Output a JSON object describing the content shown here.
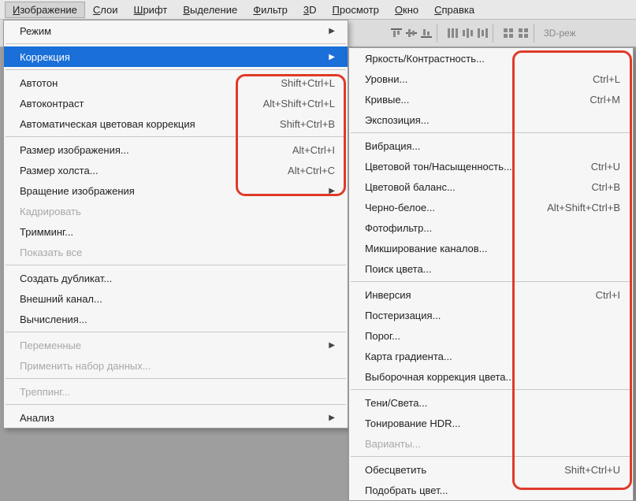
{
  "menubar": {
    "items": [
      {
        "label": "Изображение",
        "ukey": "И"
      },
      {
        "label": "Слои",
        "ukey": "С"
      },
      {
        "label": "Шрифт",
        "ukey": "Ш"
      },
      {
        "label": "Выделение",
        "ukey": "В"
      },
      {
        "label": "Фильтр",
        "ukey": "Ф"
      },
      {
        "label": "3D",
        "ukey": "3"
      },
      {
        "label": "Просмотр",
        "ukey": "П"
      },
      {
        "label": "Окно",
        "ukey": "О"
      },
      {
        "label": "Справка",
        "ukey": "С"
      }
    ]
  },
  "toolbar": {
    "mode_label": "3D-реж"
  },
  "menu1": {
    "groups": [
      [
        {
          "label": "Режим",
          "submenu": true
        }
      ],
      [
        {
          "label": "Коррекция",
          "submenu": true,
          "highlighted": true
        }
      ],
      [
        {
          "label": "Автотон",
          "shortcut": "Shift+Ctrl+L"
        },
        {
          "label": "Автоконтраст",
          "shortcut": "Alt+Shift+Ctrl+L"
        },
        {
          "label": "Автоматическая цветовая коррекция",
          "shortcut": "Shift+Ctrl+B"
        }
      ],
      [
        {
          "label": "Размер изображения...",
          "shortcut": "Alt+Ctrl+I"
        },
        {
          "label": "Размер холста...",
          "shortcut": "Alt+Ctrl+C"
        },
        {
          "label": "Вращение изображения",
          "submenu": true
        },
        {
          "label": "Кадрировать",
          "disabled": true
        },
        {
          "label": "Тримминг..."
        },
        {
          "label": "Показать все",
          "disabled": true
        }
      ],
      [
        {
          "label": "Создать дубликат..."
        },
        {
          "label": "Внешний канал..."
        },
        {
          "label": "Вычисления..."
        }
      ],
      [
        {
          "label": "Переменные",
          "submenu": true,
          "disabled": true
        },
        {
          "label": "Применить набор данных...",
          "disabled": true
        }
      ],
      [
        {
          "label": "Треппинг...",
          "disabled": true
        }
      ],
      [
        {
          "label": "Анализ",
          "submenu": true
        }
      ]
    ]
  },
  "menu2": {
    "groups": [
      [
        {
          "label": "Яркость/Контрастность..."
        },
        {
          "label": "Уровни...",
          "shortcut": "Ctrl+L"
        },
        {
          "label": "Кривые...",
          "shortcut": "Ctrl+M"
        },
        {
          "label": "Экспозиция..."
        }
      ],
      [
        {
          "label": "Вибрация..."
        },
        {
          "label": "Цветовой тон/Насыщенность...",
          "shortcut": "Ctrl+U"
        },
        {
          "label": "Цветовой баланс...",
          "shortcut": "Ctrl+B"
        },
        {
          "label": "Черно-белое...",
          "shortcut": "Alt+Shift+Ctrl+B"
        },
        {
          "label": "Фотофильтр..."
        },
        {
          "label": "Микширование каналов..."
        },
        {
          "label": "Поиск цвета..."
        }
      ],
      [
        {
          "label": "Инверсия",
          "shortcut": "Ctrl+I"
        },
        {
          "label": "Постеризация..."
        },
        {
          "label": "Порог..."
        },
        {
          "label": "Карта градиента..."
        },
        {
          "label": "Выборочная коррекция цвета..."
        }
      ],
      [
        {
          "label": "Тени/Света..."
        },
        {
          "label": "Тонирование HDR..."
        },
        {
          "label": "Варианты...",
          "disabled": true
        }
      ],
      [
        {
          "label": "Обесцветить",
          "shortcut": "Shift+Ctrl+U"
        },
        {
          "label": "Подобрать цвет..."
        }
      ]
    ]
  }
}
